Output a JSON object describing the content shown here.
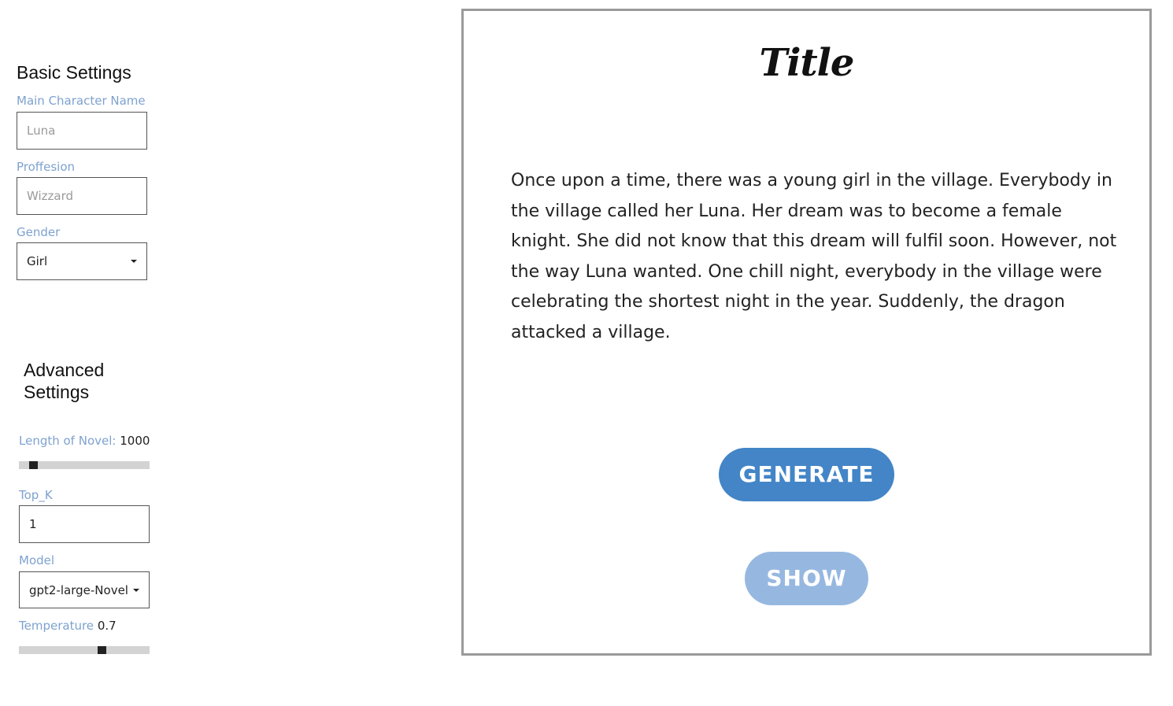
{
  "basic_settings": {
    "heading": "Basic Settings",
    "character_name": {
      "label": "Main Character Name",
      "value": "",
      "placeholder": "Luna"
    },
    "profession": {
      "label": "Proffesion",
      "value": "",
      "placeholder": "Wizzard"
    },
    "gender": {
      "label": "Gender",
      "selected": "Girl"
    }
  },
  "advanced_settings": {
    "heading_line1": "Advanced",
    "heading_line2": "Settings",
    "length": {
      "label": "Length of Novel:",
      "value": "1000",
      "slider_fraction": 0.11
    },
    "top_k": {
      "label": "Top_K",
      "value": "1"
    },
    "model": {
      "label": "Model",
      "selected": "gpt2-large-Novel"
    },
    "temperature": {
      "label": "Temperature",
      "value": "0.7",
      "slider_fraction": 0.63
    }
  },
  "story": {
    "title": "Title",
    "text": "Once upon a time, there was a young girl in the village. Everybody in the village called her Luna. Her dream was to become a female knight. She did not know that this dream will fulfil soon. However, not the way Luna wanted. One chill night, everybody in the village were celebrating the shortest night in the year. Suddenly, the dragon attacked a village."
  },
  "buttons": {
    "generate": "GENERATE",
    "show": "SHOW"
  },
  "colors": {
    "label_blue": "#7ea2cf",
    "generate_blue": "#4385c7",
    "show_blue": "#96b8e0",
    "panel_border": "#9a9a9a"
  }
}
